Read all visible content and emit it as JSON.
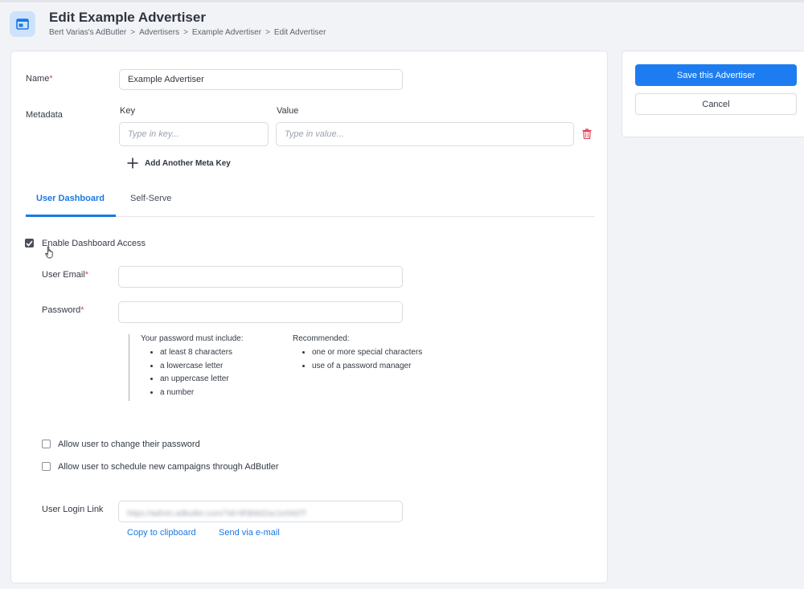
{
  "header": {
    "title": "Edit Example Advertiser",
    "breadcrumbs": [
      "Bert Varias's AdButler",
      "Advertisers",
      "Example Advertiser",
      "Edit Advertiser"
    ],
    "separator": ">"
  },
  "form": {
    "name_label": "Name",
    "name_value": "Example Advertiser",
    "metadata_label": "Metadata",
    "key_label": "Key",
    "value_label": "Value",
    "key_placeholder": "Type in key...",
    "value_placeholder": "Type in value...",
    "add_meta_label": "Add Another Meta Key",
    "required_mark": "*"
  },
  "tabs": [
    {
      "label": "User Dashboard",
      "active": true
    },
    {
      "label": "Self-Serve",
      "active": false
    }
  ],
  "dashboard": {
    "enable_access_label": "Enable Dashboard Access",
    "enable_access_checked": true,
    "user_email_label": "User Email",
    "user_email_value": "",
    "password_label": "Password",
    "password_value": "",
    "must_include_heading": "Your password must include:",
    "must_include": [
      "at least 8 characters",
      "a lowercase letter",
      "an uppercase letter",
      "a number"
    ],
    "recommended_heading": "Recommended:",
    "recommended": [
      "one or more special characters",
      "use of a password manager"
    ],
    "allow_change_password_label": "Allow user to change their password",
    "allow_change_password_checked": false,
    "allow_schedule_label": "Allow user to schedule new campaigns through AdButler",
    "allow_schedule_checked": false,
    "login_link_label": "User Login Link",
    "login_link_value": "https://admin.adbutler.com/?id=9f3b8d2ac1e04d7f",
    "copy_label": "Copy to clipboard",
    "email_label": "Send via e-mail"
  },
  "actions": {
    "save_label": "Save this Advertiser",
    "cancel_label": "Cancel"
  },
  "colors": {
    "accent": "#1b78e2",
    "primary_button": "#1d7df0",
    "required": "#e0455a",
    "delete": "#e0455a"
  }
}
